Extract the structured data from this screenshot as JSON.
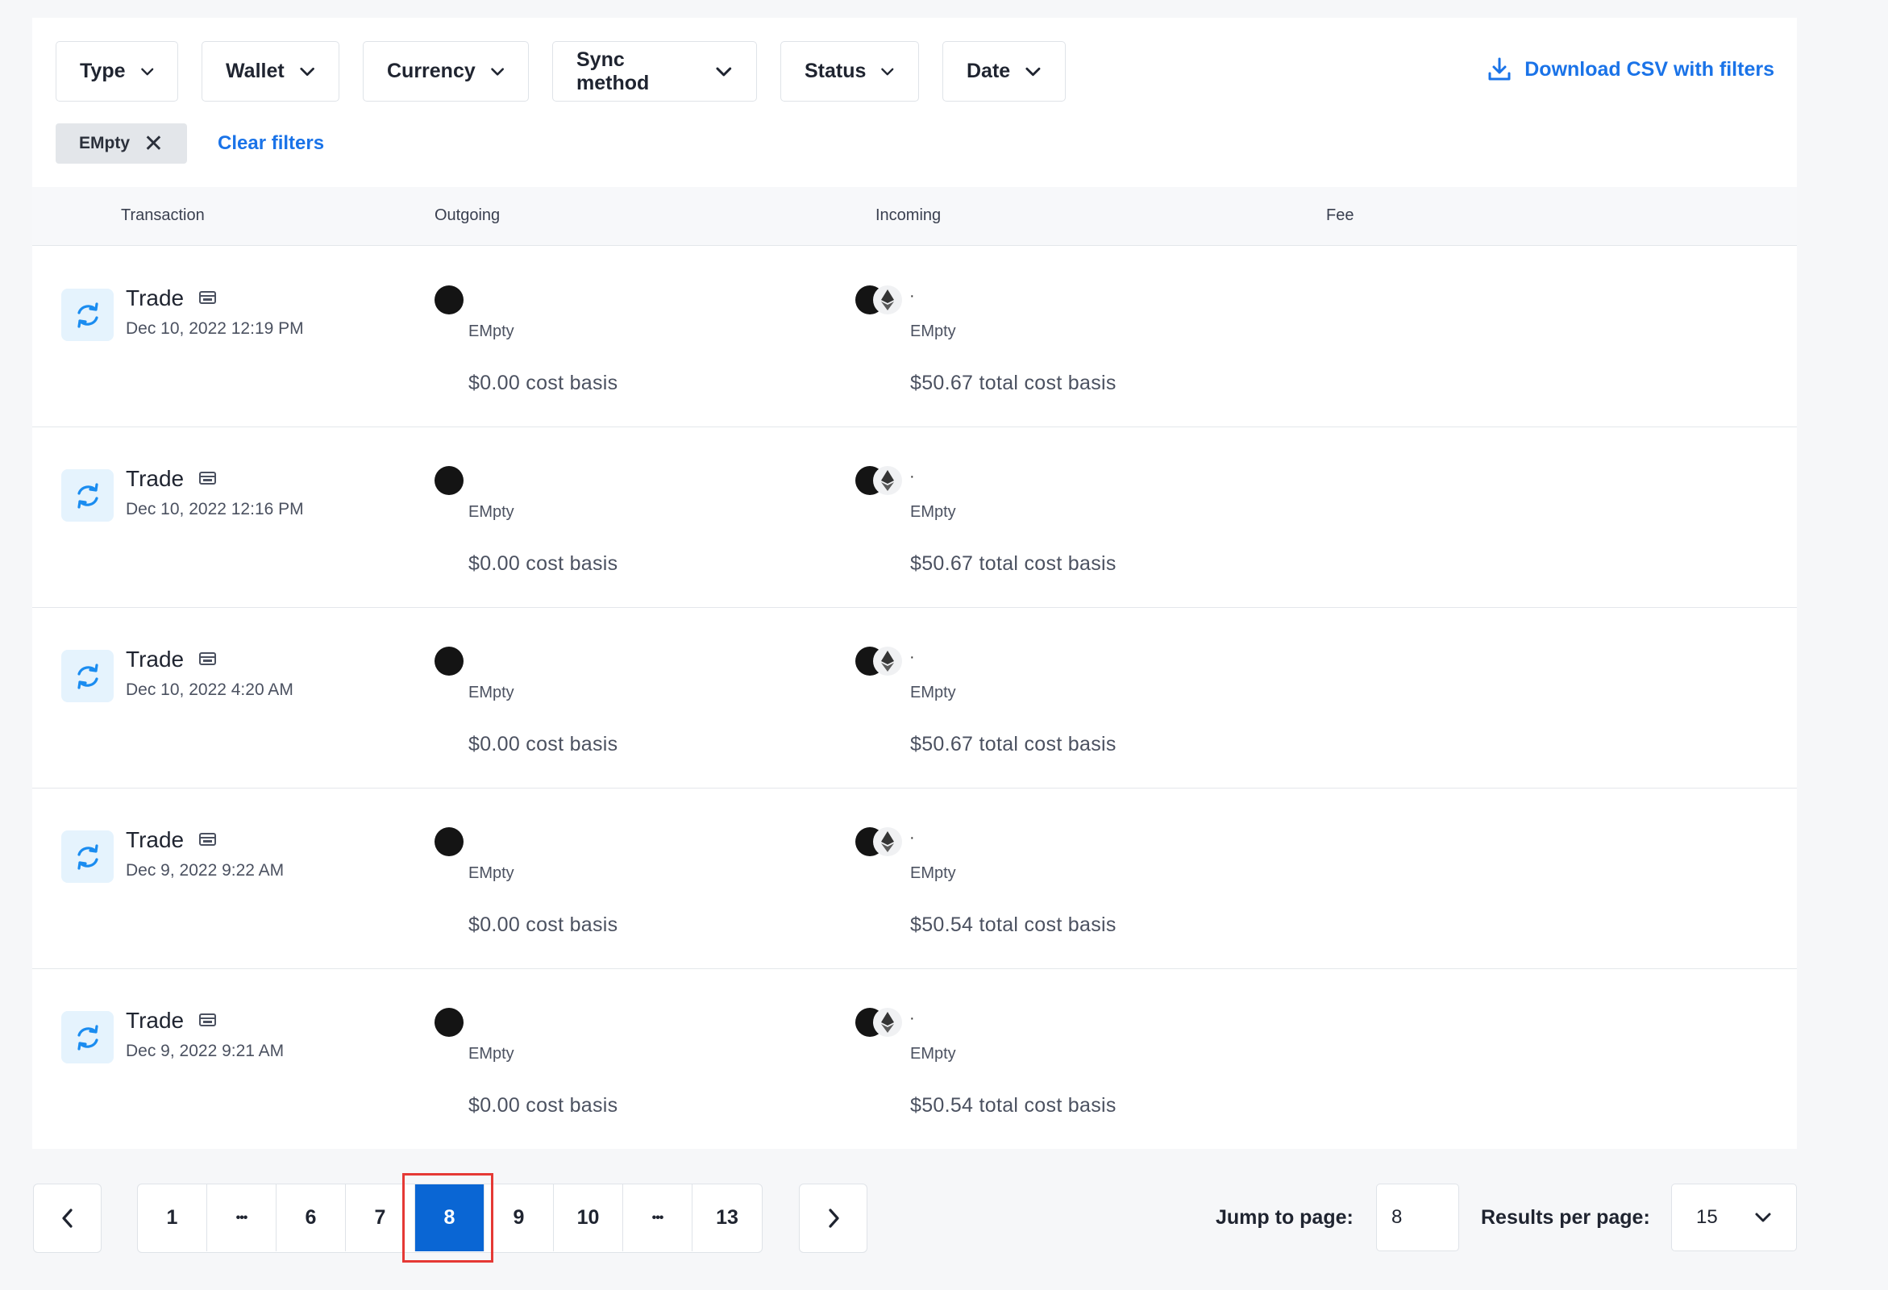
{
  "filters": {
    "buttons": [
      {
        "label": "Type"
      },
      {
        "label": "Wallet"
      },
      {
        "label": "Currency"
      },
      {
        "label": "Sync method"
      },
      {
        "label": "Status"
      },
      {
        "label": "Date"
      }
    ],
    "download_label": "Download CSV with filters",
    "active_chip": "EMpty",
    "clear_label": "Clear filters"
  },
  "table": {
    "columns": [
      "Transaction",
      "Outgoing",
      "Incoming",
      "Fee"
    ],
    "rows": [
      {
        "type": "Trade",
        "date": "Dec 10, 2022 12:19 PM",
        "out_asset": "EMpty",
        "out_basis": "$0.00 cost basis",
        "in_dot": "·",
        "in_asset": "EMpty",
        "in_basis": "$50.67 total cost basis"
      },
      {
        "type": "Trade",
        "date": "Dec 10, 2022 12:16 PM",
        "out_asset": "EMpty",
        "out_basis": "$0.00 cost basis",
        "in_dot": "·",
        "in_asset": "EMpty",
        "in_basis": "$50.67 total cost basis"
      },
      {
        "type": "Trade",
        "date": "Dec 10, 2022 4:20 AM",
        "out_asset": "EMpty",
        "out_basis": "$0.00 cost basis",
        "in_dot": "·",
        "in_asset": "EMpty",
        "in_basis": "$50.67 total cost basis"
      },
      {
        "type": "Trade",
        "date": "Dec 9, 2022 9:22 AM",
        "out_asset": "EMpty",
        "out_basis": "$0.00 cost basis",
        "in_dot": "·",
        "in_asset": "EMpty",
        "in_basis": "$50.54 total cost basis"
      },
      {
        "type": "Trade",
        "date": "Dec 9, 2022 9:21 AM",
        "out_asset": "EMpty",
        "out_basis": "$0.00 cost basis",
        "in_dot": "·",
        "in_asset": "EMpty",
        "in_basis": "$50.54 total cost basis"
      }
    ]
  },
  "pagination": {
    "pages": [
      "1",
      "•••",
      "6",
      "7",
      "8",
      "9",
      "10",
      "•••",
      "13"
    ],
    "current": "8",
    "jump_label": "Jump to page:",
    "jump_value": "8",
    "results_label": "Results per page:",
    "results_value": "15"
  },
  "icons": {
    "filter_chevron": "chevron-down-icon",
    "download": "download-icon",
    "remove_chip": "close-icon",
    "transaction": "trade-swap-icon",
    "wallet": "wallet-icon",
    "prev": "chevron-left-icon",
    "next": "chevron-right-icon"
  },
  "colors": {
    "accent": "#1a73e8",
    "active_page": "#0a66d4",
    "highlight": "#e53935",
    "trade_icon_bg": "#e5f3fd"
  }
}
